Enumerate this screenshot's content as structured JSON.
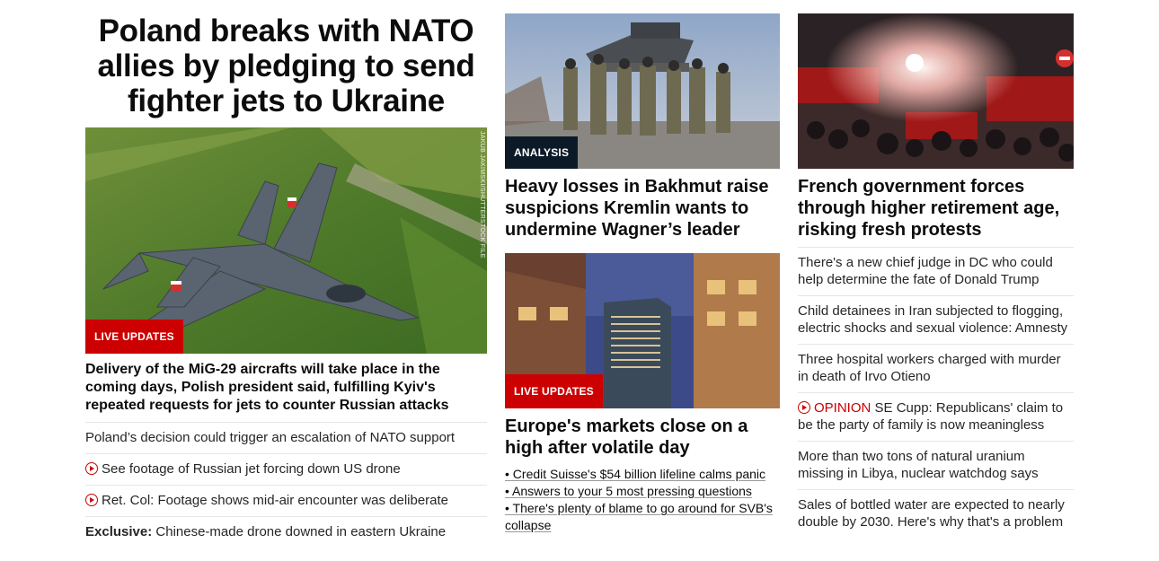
{
  "lead": {
    "headline": "Poland breaks with NATO allies by pledging to send fighter jets to Ukraine",
    "image_credit": "JAKUB JAKIMSKI/SHUTTERSTOCK FILE",
    "badge": "LIVE UPDATES",
    "summary": "Delivery of the MiG-29 aircrafts will take place in the coming days, Polish president said, fulfilling Kyiv's repeated requests for jets to counter Russian attacks",
    "related": [
      {
        "text": "Poland’s decision could trigger an escalation of NATO support",
        "video": false
      },
      {
        "text": "See footage of Russian jet forcing down US drone",
        "video": true
      },
      {
        "text": "Ret. Col: Footage shows mid-air encounter was deliberate",
        "video": true
      },
      {
        "prefix": "Exclusive:",
        "text": "Chinese-made drone downed in eastern Ukraine",
        "video": false
      }
    ]
  },
  "middle": {
    "card1": {
      "badge": "ANALYSIS",
      "headline": "Heavy losses in Bakhmut raise suspicions Kremlin wants to undermine Wagner’s leader"
    },
    "card2": {
      "badge": "LIVE UPDATES",
      "headline": "Europe's markets close on a high after volatile day",
      "bullets": [
        "• Credit Suisse's $54 billion lifeline calms panic",
        "• Answers to your 5 most pressing questions",
        "• There's plenty of blame to go around for SVB's collapse"
      ]
    }
  },
  "right": {
    "card": {
      "headline": "French government forces through higher retirement age, risking fresh protests"
    },
    "list": [
      {
        "text": "There's a new chief judge in DC who could help determine the fate of Donald Trump"
      },
      {
        "text": "Child detainees in Iran subjected to flogging, electric shocks and sexual violence: Amnesty"
      },
      {
        "text": "Three hospital workers charged with murder in death of Irvo Otieno"
      },
      {
        "label": "OPINION",
        "text": "SE Cupp: Republicans' claim to be the party of family is now meaningless"
      },
      {
        "text": "More than two tons of natural uranium missing in Libya, nuclear watchdog says"
      },
      {
        "text": "Sales of bottled water are expected to nearly double by 2030. Here's why that's a problem"
      }
    ]
  },
  "colors": {
    "live": "#cc0000",
    "analysis": "#0c1a28",
    "opinion": "#cc0000"
  }
}
